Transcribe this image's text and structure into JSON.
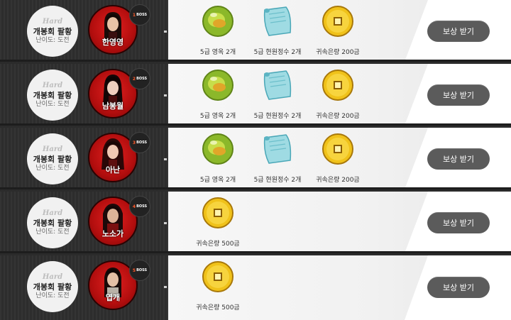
{
  "difficulty_script": "Hard",
  "rows": [
    {
      "difficulty_name": "개봉회 팔황",
      "difficulty_sub": "난이도: 도전",
      "boss_number": "1",
      "boss_tag": "BOSS",
      "boss_name": "한영영",
      "rewards": [
        {
          "icon": "jade-orb-icon",
          "label": "5급 영옥 2개"
        },
        {
          "icon": "scroll-icon",
          "label": "5급 현원정수 2개"
        },
        {
          "icon": "gold-coin-icon",
          "label": "귀속은량 200금"
        }
      ],
      "claim_label": "보상 받기"
    },
    {
      "difficulty_name": "개봉회 팔황",
      "difficulty_sub": "난이도: 도전",
      "boss_number": "2",
      "boss_tag": "BOSS",
      "boss_name": "남봉월",
      "rewards": [
        {
          "icon": "jade-orb-icon",
          "label": "5급 영옥 2개"
        },
        {
          "icon": "scroll-icon",
          "label": "5급 현원정수 2개"
        },
        {
          "icon": "gold-coin-icon",
          "label": "귀속은량 200금"
        }
      ],
      "claim_label": "보상 받기"
    },
    {
      "difficulty_name": "개봉회 팔황",
      "difficulty_sub": "난이도: 도전",
      "boss_number": "3",
      "boss_tag": "BOSS",
      "boss_name": "아난",
      "rewards": [
        {
          "icon": "jade-orb-icon",
          "label": "5급 영옥 2개"
        },
        {
          "icon": "scroll-icon",
          "label": "5급 현원정수 2개"
        },
        {
          "icon": "gold-coin-icon",
          "label": "귀속은량 200금"
        }
      ],
      "claim_label": "보상 받기"
    },
    {
      "difficulty_name": "개봉회 팔황",
      "difficulty_sub": "난이도: 도전",
      "boss_number": "4",
      "boss_tag": "BOSS",
      "boss_name": "노소가",
      "rewards": [
        {
          "icon": "gold-coin-icon",
          "label": "귀속은량 500금"
        }
      ],
      "claim_label": "보상 받기"
    },
    {
      "difficulty_name": "개봉회 팔황",
      "difficulty_sub": "난이도: 도전",
      "boss_number": "5",
      "boss_tag": "BOSS",
      "boss_name": "엽개",
      "rewards": [
        {
          "icon": "gold-coin-icon",
          "label": "귀속은량 500금"
        }
      ],
      "claim_label": "보상 받기"
    }
  ]
}
